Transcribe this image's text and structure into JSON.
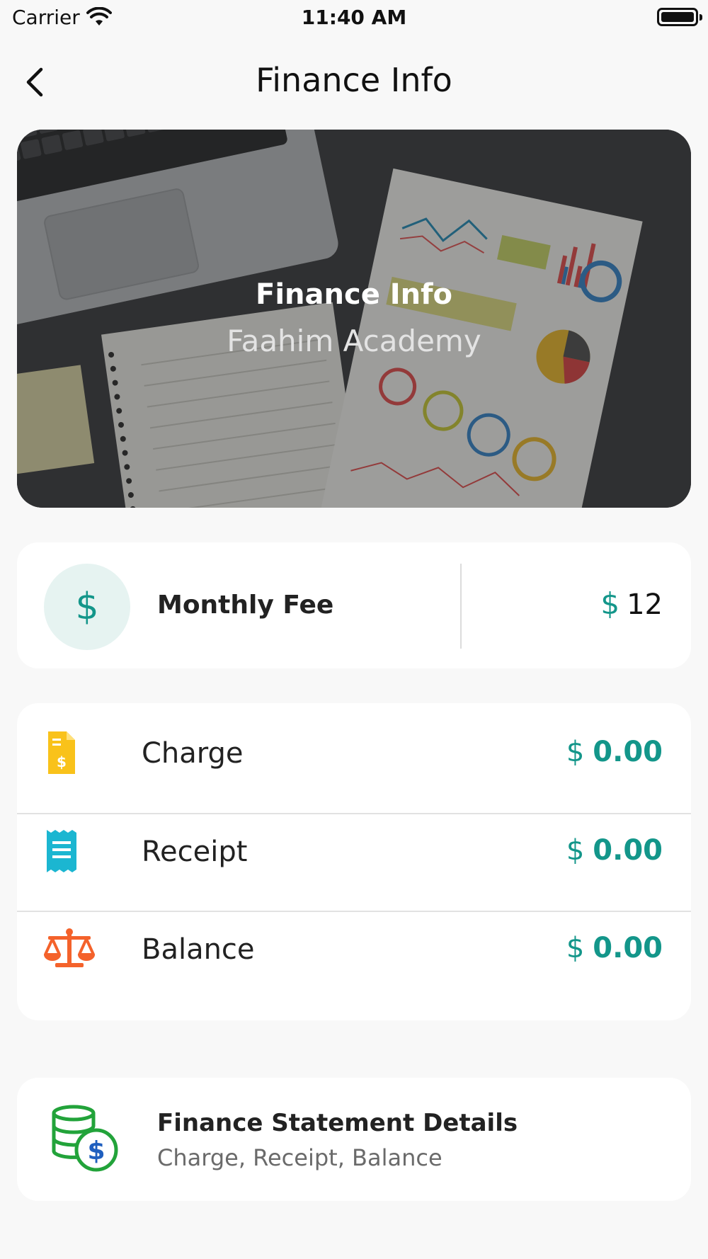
{
  "status_bar": {
    "carrier": "Carrier",
    "time": "11:40 AM"
  },
  "nav": {
    "title": "Finance Info"
  },
  "banner": {
    "title": "Finance Info",
    "subtitle": "Faahim Academy"
  },
  "monthly_fee": {
    "icon_symbol": "$",
    "label": "Monthly Fee",
    "currency": "$",
    "amount": "12"
  },
  "summary": {
    "rows": [
      {
        "label": "Charge",
        "currency": "$",
        "amount": "0.00",
        "icon": "invoice-icon",
        "icon_color": "#f9c21a"
      },
      {
        "label": "Receipt",
        "currency": "$",
        "amount": "0.00",
        "icon": "receipt-icon",
        "icon_color": "#1bb6d1"
      },
      {
        "label": "Balance",
        "currency": "$",
        "amount": "0.00",
        "icon": "scale-icon",
        "icon_color": "#f4622b"
      }
    ]
  },
  "statement": {
    "title": "Finance Statement Details",
    "subtitle": "Charge, Receipt, Balance",
    "icon": "coins-dollar-icon",
    "icon_color": "#22a33a"
  },
  "colors": {
    "accent": "#13968a",
    "background": "#f8f8f8",
    "card": "#ffffff"
  }
}
